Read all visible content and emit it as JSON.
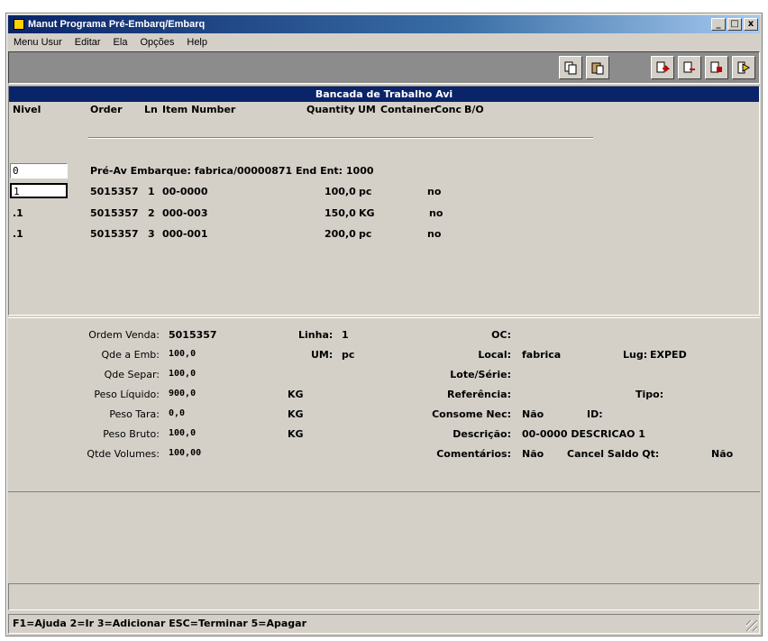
{
  "window": {
    "title": "Manut Programa Pré-Embarq/Embarq",
    "controls": [
      "_",
      "□",
      "x"
    ]
  },
  "menu": [
    "Menu Usur",
    "Editar",
    "Ela",
    "Opções",
    "Help"
  ],
  "toolbar": {
    "buttons": [
      "copy-icon",
      "paste-icon",
      "go-back-icon",
      "go-forward-icon",
      "go-next-icon",
      "exit-icon"
    ]
  },
  "workbench": {
    "title": "Bancada de Trabalho Avi",
    "headers": {
      "nivel": "Nivel",
      "order": "Order",
      "ln": "Ln",
      "item_number": "Item Number",
      "quantity": "Quantity",
      "um": "UM",
      "container": "Container",
      "conc": "Conc",
      "bo": "B/O"
    },
    "rows": [
      {
        "level": "0",
        "text": "Pré-Av Embarque: fabrica/00000871  End Ent: 1000"
      },
      {
        "level": "1",
        "order": "5015357",
        "ln": "1",
        "item": "00-0000",
        "qty": "100,0",
        "um": "pc",
        "status": "no"
      },
      {
        "level": ".1",
        "order": "5015357",
        "ln": "2",
        "item": "000-003",
        "qty": "150,0",
        "um": "KG",
        "status": "no"
      },
      {
        "level": ".1",
        "order": "5015357",
        "ln": "3",
        "item": "000-001",
        "qty": "200,0",
        "um": "pc",
        "status": "no"
      }
    ]
  },
  "details": {
    "ordem_venda_label": "Ordem Venda:",
    "ordem_venda_value": "5015357",
    "linha_label": "Linha:",
    "linha_value": "1",
    "oc_label": "OC:",
    "oc_value": "",
    "qde_emb_label": "Qde a Emb:",
    "qde_emb_value": "100,0",
    "um_label": "UM:",
    "um_value": "pc",
    "local_label": "Local:",
    "local_value": "fabrica",
    "lug_label": "Lug:",
    "lug_value": "EXPED",
    "qde_separ_label": "Qde Separ:",
    "qde_separ_value": "100,0",
    "lote_label": "Lote/Série:",
    "lote_value": "",
    "peso_liq_label": "Peso Líquido:",
    "peso_liq_value": "900,0",
    "peso_liq_unit": "KG",
    "referencia_label": "Referência:",
    "referencia_value": "",
    "tipo_label": "Tipo:",
    "tipo_value": "",
    "peso_tara_label": "Peso Tara:",
    "peso_tara_value": "0,0",
    "peso_tara_unit": "KG",
    "consome_label": "Consome Nec:",
    "consome_value": "Não",
    "id_label": "ID:",
    "id_value": "",
    "peso_bruto_label": "Peso Bruto:",
    "peso_bruto_value": "100,0",
    "peso_bruto_unit": "KG",
    "descricao_label": "Descrição:",
    "descricao_value": "00-0000 DESCRICAO 1",
    "qtde_vol_label": "Qtde Volumes:",
    "qtde_vol_value": "100,00",
    "comentarios_label": "Comentários:",
    "comentarios_value": "Não",
    "cancel_label": "Cancel Saldo Qt:",
    "cancel_value": "Não"
  },
  "status": "F1=Ajuda 2=Ir 3=Adicionar ESC=Terminar 5=Apagar"
}
